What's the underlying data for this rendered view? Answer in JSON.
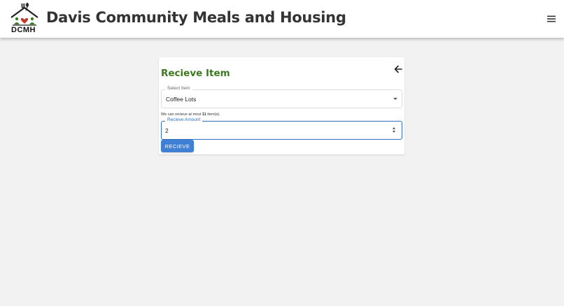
{
  "header": {
    "logo_text": "DCMH",
    "title": "Davis Community Meals and Housing",
    "menu_icon": "hamburger-menu-icon"
  },
  "form": {
    "back_icon": "arrow-left-icon",
    "title": "Recieve Item",
    "select": {
      "label": "Select Item",
      "value": "Coffee Lots"
    },
    "hint": {
      "prefix": "We can recieve at most ",
      "max": "11",
      "suffix": " item(s)."
    },
    "amount": {
      "label": "Recieve Amount",
      "value": "2"
    },
    "submit_label": "RECIEVE"
  },
  "colors": {
    "title_green": "#3b7a1e",
    "accent_blue": "#3f7fd4",
    "background": "#f2f2f2"
  }
}
